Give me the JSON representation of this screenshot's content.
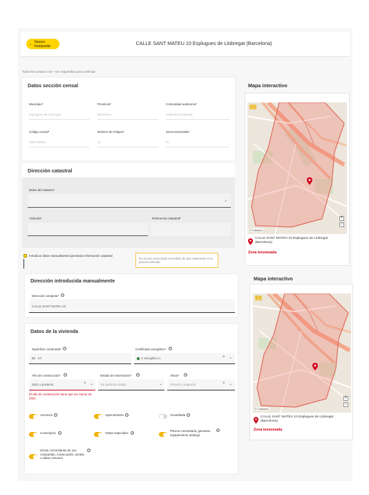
{
  "header": {
    "back_label": "Nuevo búsqueda",
    "address": "CALLE SANT MATEU 10 Esplugues de Llobregat (Barcelona)"
  },
  "required_note": "Todos los campos con * son requeridos para continuar",
  "census": {
    "title": "Datos sección censal",
    "municipio_label": "Municipio*",
    "municipio_value": "Esplugues de Llobregat",
    "provincia_label": "Provincia*",
    "provincia_value": "Barcelona",
    "comunidad_label": "Comunidad autónoma*",
    "comunidad_value": "Cataluña/Catalunya",
    "codigo_label": "Código censal*",
    "codigo_value": "0807706003",
    "numero_label": "Número de troligos*",
    "numero_value": "41",
    "zona_label": "Zona tensionada*",
    "zona_value": "Sí"
  },
  "catastral": {
    "title": "Dirección catastral",
    "datos_label": "Datos del catastro*",
    "vivienda_label": "Vivienda*",
    "referencia_label": "Referencia Catastral*"
  },
  "manual": {
    "checkbox_label": "Introducir datos manualmente ignorando información catastral",
    "warning": "No se han encontrado inmuebles de tipo residencial en la parcela indicada"
  },
  "map1": {
    "title": "Mapa interactivo",
    "credit": "© Catastro",
    "pin_address_line1": "CALLE SANT MATEU 10 Esplugues de Llobregat",
    "pin_address_line2": "(Barcelona)",
    "zone": "Zona tensionada"
  },
  "manual_address": {
    "title": "Dirección introducida manualmente",
    "full_label": "Dirección completa*",
    "full_value": "CALLE SANT MATEU 10"
  },
  "dwelling": {
    "title": "Datos de la vivienda",
    "superficie_label": "Superficie construida*",
    "superficie_value": "58",
    "superficie_unit": "m²",
    "certificado_label": "Certificado energético*",
    "certificado_value": "C energético A",
    "anio_label": "Año de construcción*",
    "anio_value": "2021 o posterior",
    "estado_label": "Estado de reservación*",
    "estado_value": "En perfecto estado",
    "altura_label": "Altura*",
    "altura_value": "Primero o segundo",
    "error": "El año de construcción tiene que ser menor de 2021",
    "toggles": [
      {
        "label": "Ascensor",
        "on": true
      },
      {
        "label": "Aparcamiento",
        "on": true
      },
      {
        "label": "Amueblada",
        "on": false
      },
      {
        "label": "Conserjería",
        "on": true
      },
      {
        "label": "Vistas especiales",
        "on": true
      },
      {
        "label": "Piscina comunitaria, gimnasio, equipamiento análogo",
        "on": true
      },
      {
        "label": "Zonas comunitarias de uso compartido, zonas jardín, azotea o salas comunes",
        "on": true
      }
    ]
  },
  "map2": {
    "title": "Mapa interactivo",
    "credit": "© Catastro",
    "pin_address_line1": "CALLE SANT MATEU 10 Esplugues de Llobregat",
    "pin_address_line2": "(Barcelona)",
    "zone": "Zona tensionada"
  },
  "colors": {
    "accent": "#ffd400",
    "danger": "#d0021b",
    "toggle_on": "#f3b200"
  }
}
